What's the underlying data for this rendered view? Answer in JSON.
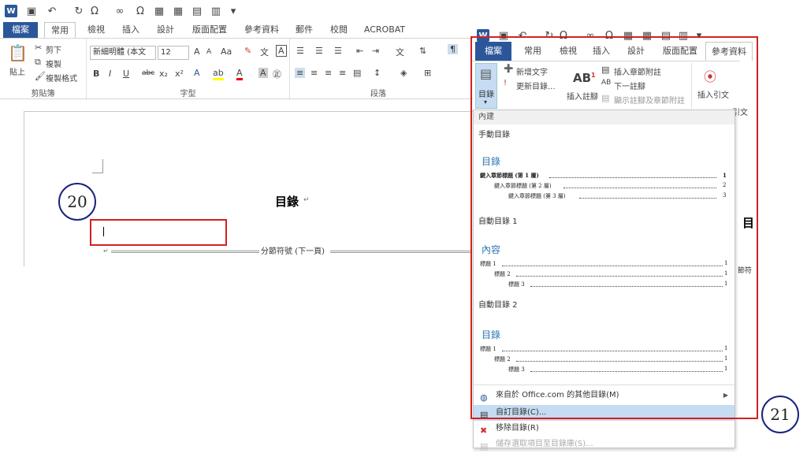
{
  "qat": {
    "save_icon": "save-icon",
    "undo_icon": "undo-icon",
    "symbol": "Ω",
    "infinity": "∞",
    "omega": "Ω"
  },
  "tabs": [
    "檔案",
    "常用",
    "檢視",
    "插入",
    "設計",
    "版面配置",
    "參考資料",
    "郵件",
    "校閱",
    "ACROBAT"
  ],
  "clipboard": {
    "paste": "貼上",
    "cut": "剪下",
    "copy": "複製",
    "format_painter": "複製格式",
    "label": "剪貼簿"
  },
  "font": {
    "name": "新細明體 (本文",
    "size": "12",
    "label": "字型",
    "bold": "B",
    "italic": "I",
    "underline": "U",
    "strike": "abc",
    "sub": "x₂",
    "sup": "x²",
    "aa": "Aa",
    "grow": "A",
    "shrink": "A"
  },
  "paragraph": {
    "label": "段落"
  },
  "doc": {
    "title": "目錄",
    "section_break": "分節符號 (下一頁)",
    "pilcrow": "↵"
  },
  "callouts": {
    "c20": "20",
    "c21": "21"
  },
  "overlay": {
    "tabs": [
      "檔案",
      "常用",
      "檢視",
      "插入",
      "設計",
      "版面配置",
      "參考資料"
    ],
    "toc_button": "目錄",
    "add_text": "新增文字",
    "update_toc": "更新目錄...",
    "insert_footnote": "插入註腳",
    "insert_endnote": "插入章節附註",
    "next_footnote": "下一註腳",
    "show_notes": "顯示註腳及章節附註",
    "insert_citation": "插入引文",
    "citation_label": "引文"
  },
  "menu": {
    "section_builtin": "內建",
    "manual_toc": "手動目錄",
    "manual_title": "目錄",
    "manual_lines": [
      {
        "text": "鍵入章節標題 (第 1 層)",
        "page": "1",
        "level": 1
      },
      {
        "text": "鍵入章節標題 (第 2 層)",
        "page": "2",
        "level": 2
      },
      {
        "text": "鍵入章節標題 (第 3 層)",
        "page": "3",
        "level": 3
      }
    ],
    "auto1": "自動目錄 1",
    "auto1_title": "內容",
    "auto1_lines": [
      {
        "text": "標題 1",
        "page": "1",
        "level": 1
      },
      {
        "text": "標題 2",
        "page": "1",
        "level": 2
      },
      {
        "text": "標題 3",
        "page": "1",
        "level": 3
      }
    ],
    "auto2": "自動目錄 2",
    "auto2_title": "目錄",
    "auto2_lines": [
      {
        "text": "標題 1",
        "page": "1",
        "level": 1
      },
      {
        "text": "標題 2",
        "page": "1",
        "level": 2
      },
      {
        "text": "標題 3",
        "page": "1",
        "level": 3
      }
    ],
    "more_toc": "來自於 Office.com 的其他目錄(M)",
    "custom_toc": "自訂目錄(C)...",
    "remove_toc": "移除目錄(R)",
    "save_selection": "儲存選取項目至目錄庫(S)..."
  }
}
